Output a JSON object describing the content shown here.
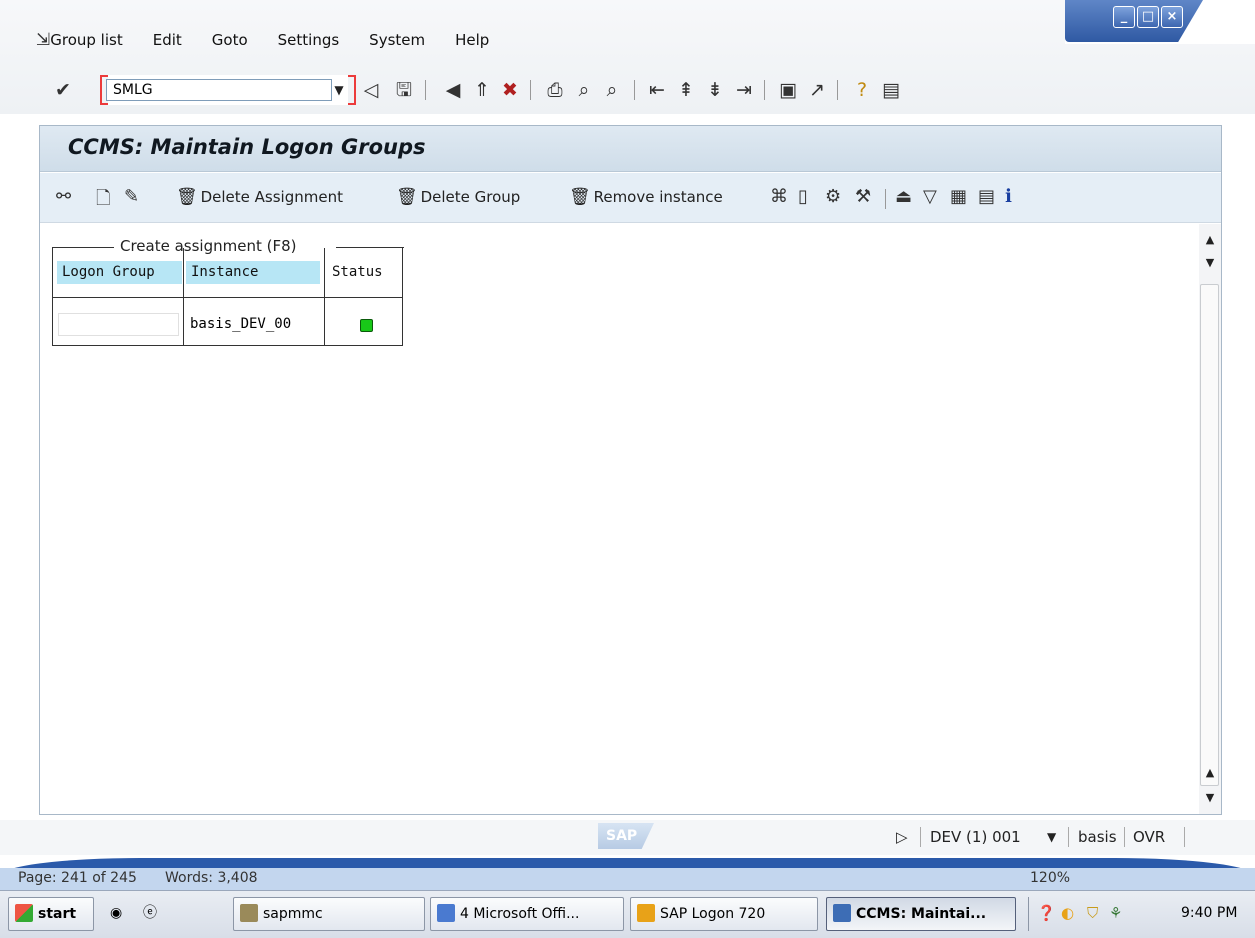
{
  "menu": {
    "items": [
      "Group list",
      "Edit",
      "Goto",
      "Settings",
      "System",
      "Help"
    ]
  },
  "toolbar": {
    "command_value": "SMLG"
  },
  "page": {
    "title": "CCMS: Maintain Logon Groups"
  },
  "app_toolbar": {
    "delete_assignment": "Delete Assignment",
    "delete_group": "Delete Group",
    "remove_instance": "Remove instance"
  },
  "tooltip": "Create assignment    (F8)",
  "table": {
    "headers": [
      "Logon Group",
      "Instance",
      "Status"
    ],
    "rows": [
      {
        "logon_group": "",
        "instance": "basis_DEV_00",
        "status": "green"
      }
    ]
  },
  "statusbar": {
    "logo": "SAP",
    "system": "DEV (1) 001",
    "user": "basis",
    "mode": "OVR"
  },
  "word_status": {
    "page": "Page: 241 of 245",
    "words": "Words: 3,408",
    "zoom": "120%"
  },
  "taskbar": {
    "start": "start",
    "items": [
      "sapmmc",
      "4 Microsoft Offi...",
      "SAP Logon 720",
      "CCMS: Maintai..."
    ],
    "clock": "9:40 PM"
  },
  "colors": {
    "status_green": "#18c818",
    "title_band": "#cfdde9",
    "taskbar_blue": "#2b5aaa"
  }
}
